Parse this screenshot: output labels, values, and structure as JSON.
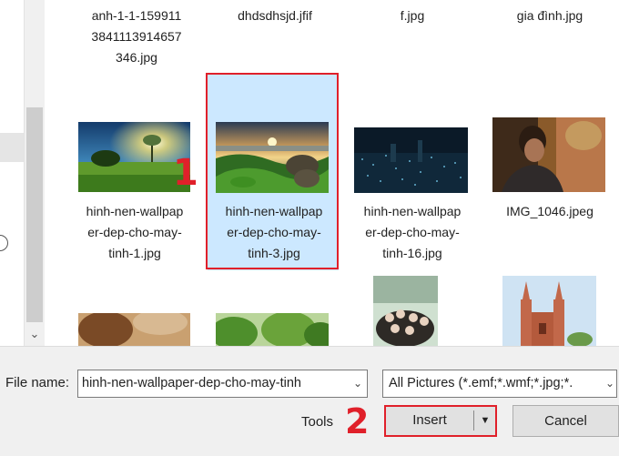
{
  "files": [
    {
      "name": "anh-1-1-159911\n3841113914657\n346.jpg"
    },
    {
      "name": "dhdsdhsjd.jfif"
    },
    {
      "name": "f.jpg"
    },
    {
      "name": "gia đình.jpg"
    },
    {
      "name": "hinh-nen-wallpap\ner-dep-cho-may-\ntinh-1.jpg"
    },
    {
      "name": "hinh-nen-wallpap\ner-dep-cho-may-\ntinh-3.jpg"
    },
    {
      "name": "hinh-nen-wallpap\ner-dep-cho-may-\ntinh-16.jpg"
    },
    {
      "name": "IMG_1046.jpeg"
    }
  ],
  "annotations": {
    "step1": "1",
    "step2": "2"
  },
  "bottom": {
    "file_name_label": "File name:",
    "file_name_value": "hinh-nen-wallpaper-dep-cho-may-tinh",
    "filter_value": "All Pictures (*.emf;*.wmf;*.jpg;*.",
    "tools_label": "Tools",
    "insert_label": "Insert",
    "cancel_label": "Cancel"
  },
  "colors": {
    "selection": "#cce8ff",
    "annotation_red": "#e0202a",
    "panel": "#f0f0f0"
  }
}
